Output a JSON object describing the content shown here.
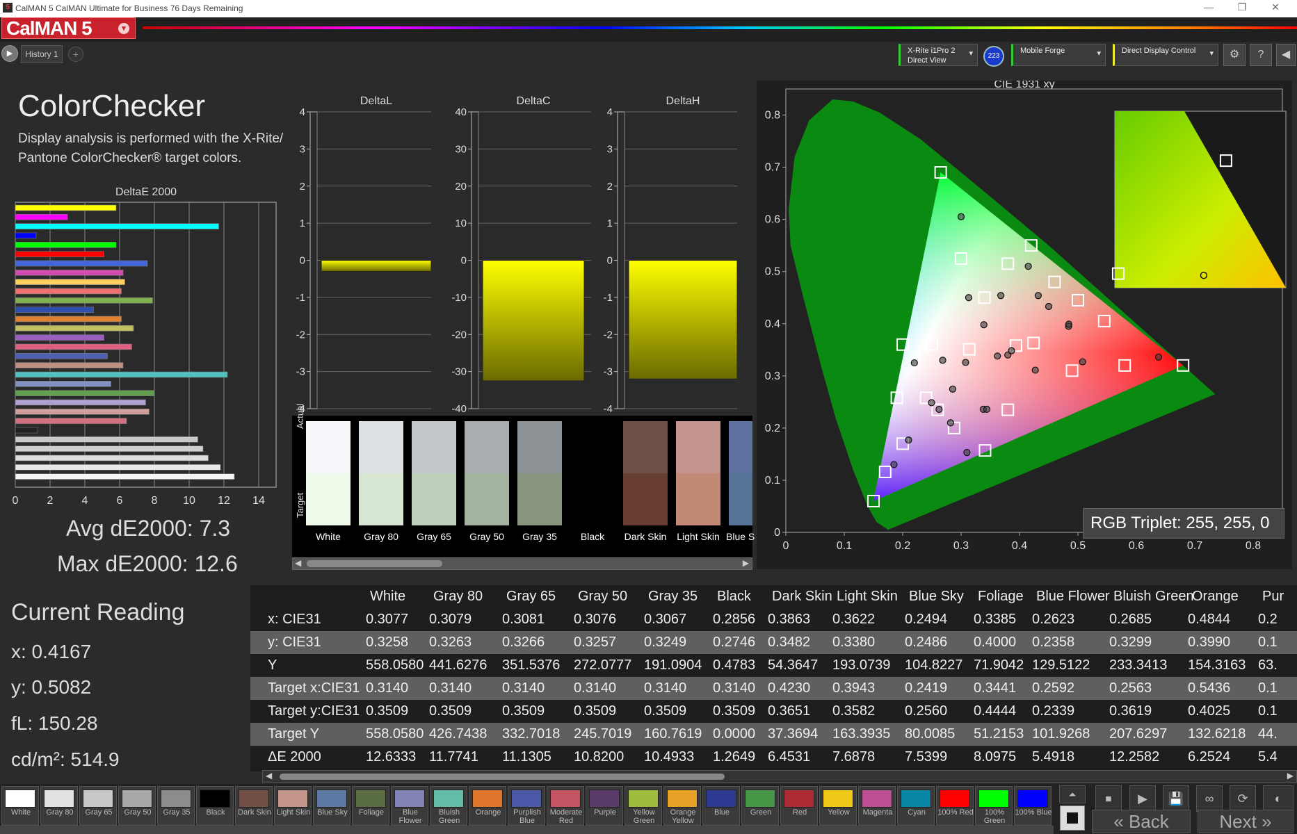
{
  "window": {
    "title": "CalMAN 5 CalMAN Ultimate for Business 76 Days Remaining",
    "minimize": "—",
    "maximize": "❐",
    "close": "✕"
  },
  "app": {
    "logo": "CalMAN 5",
    "logo_caret": "▾"
  },
  "history": {
    "play": "▶",
    "tab": "History 1",
    "add": "+"
  },
  "devices": {
    "meter_line1": "X-Rite i1Pro 2",
    "meter_line2": "Direct View",
    "meter_badge": "223",
    "source": "Mobile Forge",
    "display": "Direct Display Control",
    "caret": "▾",
    "settings_icon": "⚙",
    "help_icon": "?",
    "collapse_icon": "◀"
  },
  "panel": {
    "title": "ColorChecker",
    "subtitle": "Display analysis is performed with the X-Rite/ Pantone ColorChecker® target colors.",
    "avg": "Avg dE2000: 7.3",
    "max": "Max dE2000: 12.6"
  },
  "current_reading": {
    "title": "Current Reading",
    "x": "x: 0.4167",
    "y": "y: 0.5082",
    "fl": "fL: 150.28",
    "cdm2": "cd/m²: 514.9"
  },
  "chart_data": [
    {
      "type": "bar",
      "orientation": "horizontal",
      "title": "DeltaE 2000",
      "xlim": [
        0,
        15
      ],
      "xticks": [
        0,
        2,
        4,
        6,
        8,
        10,
        12,
        14
      ],
      "values": [
        5.8,
        3.0,
        11.7,
        1.2,
        5.8,
        5.1,
        7.6,
        6.2,
        6.3,
        6.1,
        7.9,
        4.5,
        6.1,
        6.8,
        5.1,
        6.7,
        5.3,
        6.2,
        12.2,
        5.5,
        8.0,
        7.5,
        7.7,
        6.4,
        1.3,
        10.5,
        10.8,
        11.1,
        11.8,
        12.6
      ],
      "colors": [
        "#ffff00",
        "#ff00ff",
        "#00ffff",
        "#0000ff",
        "#00ff00",
        "#ff0000",
        "#4466dd",
        "#d04cb0",
        "#ffd060",
        "#ee7070",
        "#80b050",
        "#3050b0",
        "#e08030",
        "#c0c060",
        "#9a60c0",
        "#e06080",
        "#5060b0",
        "#c09080",
        "#50c0c0",
        "#8090c0",
        "#60a050",
        "#b0a0d0",
        "#d0a0a0",
        "#d07080",
        "#222222",
        "#c8c8c8",
        "#d0d0d0",
        "#dddddd",
        "#e8e8e8",
        "#f4f4f4"
      ]
    },
    {
      "type": "bar",
      "title": "DeltaL",
      "ylim": [
        -4,
        4
      ],
      "yticks": [
        "4",
        "3",
        "2",
        "1",
        "0",
        "-1",
        "-2",
        "-3",
        "-4"
      ],
      "value": -0.3
    },
    {
      "type": "bar",
      "title": "DeltaC",
      "ylim": [
        -40,
        40
      ],
      "yticks": [
        "40",
        "30",
        "20",
        "10",
        "0",
        "-10",
        "-20",
        "-30",
        "-40"
      ],
      "value": -32.5
    },
    {
      "type": "bar",
      "title": "DeltaH",
      "ylim": [
        -4,
        4
      ],
      "yticks": [
        "4",
        "3",
        "2",
        "1",
        "0",
        "-1",
        "-2",
        "-3",
        "-4"
      ],
      "value": -3.2
    },
    {
      "type": "scatter",
      "title": "CIE 1931 xy",
      "xlim": [
        0,
        0.85
      ],
      "ylim": [
        0,
        0.85
      ],
      "xticks": [
        "0",
        "0.1",
        "0.2",
        "0.3",
        "0.4",
        "0.5",
        "0.6",
        "0.7",
        "0.8"
      ],
      "yticks": [
        "0",
        "0.1",
        "0.2",
        "0.3",
        "0.4",
        "0.5",
        "0.6",
        "0.7",
        "0.8"
      ],
      "gamut": [
        [
          0.68,
          0.32
        ],
        [
          0.265,
          0.69
        ],
        [
          0.15,
          0.06
        ]
      ],
      "targets": [
        [
          0.265,
          0.69
        ],
        [
          0.3,
          0.525
        ],
        [
          0.38,
          0.515
        ],
        [
          0.42,
          0.55
        ],
        [
          0.46,
          0.48
        ],
        [
          0.34,
          0.45
        ],
        [
          0.5,
          0.445
        ],
        [
          0.545,
          0.405
        ],
        [
          0.2,
          0.36
        ],
        [
          0.25,
          0.36
        ],
        [
          0.314,
          0.351
        ],
        [
          0.394,
          0.358
        ],
        [
          0.424,
          0.363
        ],
        [
          0.68,
          0.32
        ],
        [
          0.58,
          0.32
        ],
        [
          0.49,
          0.31
        ],
        [
          0.19,
          0.258
        ],
        [
          0.24,
          0.258
        ],
        [
          0.26,
          0.235
        ],
        [
          0.288,
          0.2
        ],
        [
          0.38,
          0.235
        ],
        [
          0.2,
          0.17
        ],
        [
          0.17,
          0.116
        ],
        [
          0.15,
          0.06
        ],
        [
          0.341,
          0.157
        ]
      ],
      "actuals": [
        [
          0.3,
          0.605
        ],
        [
          0.415,
          0.51
        ],
        [
          0.313,
          0.45
        ],
        [
          0.368,
          0.454
        ],
        [
          0.432,
          0.454
        ],
        [
          0.45,
          0.433
        ],
        [
          0.484,
          0.395
        ],
        [
          0.339,
          0.398
        ],
        [
          0.38,
          0.34
        ],
        [
          0.3077,
          0.3258
        ],
        [
          0.2856,
          0.2746
        ],
        [
          0.3863,
          0.3482
        ],
        [
          0.3622,
          0.338
        ],
        [
          0.2494,
          0.2486
        ],
        [
          0.2623,
          0.2358
        ],
        [
          0.2685,
          0.3299
        ],
        [
          0.4844,
          0.399
        ],
        [
          0.638,
          0.336
        ],
        [
          0.508,
          0.327
        ],
        [
          0.427,
          0.311
        ],
        [
          0.338,
          0.236
        ],
        [
          0.282,
          0.21
        ],
        [
          0.31,
          0.153
        ],
        [
          0.185,
          0.13
        ],
        [
          0.21,
          0.177
        ],
        [
          0.22,
          0.325
        ],
        [
          0.344,
          0.236
        ]
      ],
      "inset_targets": [
        [
          0.02,
          0.08
        ],
        [
          0.65,
          0.72
        ]
      ],
      "inset_actuals": [
        [
          0.52,
          0.07
        ]
      ]
    }
  ],
  "swatches": {
    "actual_label": "Actual",
    "target_label": "Target",
    "items": [
      {
        "name": "White",
        "actual": "#f6f8fb",
        "target": "#eef9ea"
      },
      {
        "name": "Gray 80",
        "actual": "#dde1e5",
        "target": "#d6e6d2"
      },
      {
        "name": "Gray 65",
        "actual": "#c3c8cc",
        "target": "#bfd0bc"
      },
      {
        "name": "Gray 50",
        "actual": "#a8adb2",
        "target": "#a3b39f"
      },
      {
        "name": "Gray 35",
        "actual": "#8d9296",
        "target": "#87957f"
      },
      {
        "name": "Black",
        "actual": "#000000",
        "target": "#000000"
      },
      {
        "name": "Dark Skin",
        "actual": "#6d4e48",
        "target": "#663d30"
      },
      {
        "name": "Light Skin",
        "actual": "#c3948e",
        "target": "#c28a74"
      },
      {
        "name": "Blue Sky",
        "actual": "#6072a0",
        "target": "#557396"
      }
    ]
  },
  "table": {
    "columns": [
      "White",
      "Gray 80",
      "Gray 65",
      "Gray 50",
      "Gray 35",
      "Black",
      "Dark Skin",
      "Light Skin",
      "Blue Sky",
      "Foliage",
      "Blue Flower",
      "Bluish Green",
      "Orange",
      "Pur"
    ],
    "rows": [
      {
        "label": "x: CIE31",
        "values": [
          "0.3077",
          "0.3079",
          "0.3081",
          "0.3076",
          "0.3067",
          "0.2856",
          "0.3863",
          "0.3622",
          "0.2494",
          "0.3385",
          "0.2623",
          "0.2685",
          "0.4844",
          "0.2"
        ]
      },
      {
        "label": "y: CIE31",
        "values": [
          "0.3258",
          "0.3263",
          "0.3266",
          "0.3257",
          "0.3249",
          "0.2746",
          "0.3482",
          "0.3380",
          "0.2486",
          "0.4000",
          "0.2358",
          "0.3299",
          "0.3990",
          "0.1"
        ]
      },
      {
        "label": "Y",
        "values": [
          "558.0580",
          "441.6276",
          "351.5376",
          "272.0777",
          "191.0904",
          "0.4783",
          "54.3647",
          "193.0739",
          "104.8227",
          "71.9042",
          "129.5122",
          "233.3413",
          "154.3163",
          "63."
        ]
      },
      {
        "label": "Target x:CIE31",
        "values": [
          "0.3140",
          "0.3140",
          "0.3140",
          "0.3140",
          "0.3140",
          "0.3140",
          "0.4230",
          "0.3943",
          "0.2419",
          "0.3441",
          "0.2592",
          "0.2563",
          "0.5436",
          "0.1"
        ]
      },
      {
        "label": "Target y:CIE31",
        "values": [
          "0.3509",
          "0.3509",
          "0.3509",
          "0.3509",
          "0.3509",
          "0.3509",
          "0.3651",
          "0.3582",
          "0.2560",
          "0.4444",
          "0.2339",
          "0.3619",
          "0.4025",
          "0.1"
        ]
      },
      {
        "label": "Target Y",
        "values": [
          "558.0580",
          "426.7438",
          "332.7018",
          "245.7019",
          "160.7619",
          "0.0000",
          "37.3694",
          "163.3935",
          "80.0085",
          "51.2153",
          "101.9268",
          "207.6297",
          "132.6218",
          "44."
        ]
      },
      {
        "label": "ΔE 2000",
        "values": [
          "12.6333",
          "11.7741",
          "11.1305",
          "10.8200",
          "10.4933",
          "1.2649",
          "6.4531",
          "7.6878",
          "7.5399",
          "8.0975",
          "5.4918",
          "12.2582",
          "6.2524",
          "5.4"
        ]
      }
    ]
  },
  "rgb_triplet": "RGB Triplet: 255, 255, 0",
  "bottom_swatches": [
    {
      "label": "White",
      "color": "#ffffff"
    },
    {
      "label": "Gray 80",
      "color": "#e2e2e2"
    },
    {
      "label": "Gray 65",
      "color": "#c8c8c8"
    },
    {
      "label": "Gray 50",
      "color": "#a9a9a9"
    },
    {
      "label": "Gray 35",
      "color": "#8c8c8c"
    },
    {
      "label": "Black",
      "color": "#000000"
    },
    {
      "label": "Dark Skin",
      "color": "#734e45"
    },
    {
      "label": "Light Skin",
      "color": "#c4968a"
    },
    {
      "label": "Blue Sky",
      "color": "#5d7aa4"
    },
    {
      "label": "Foliage",
      "color": "#5a6e42"
    },
    {
      "label": "Blue Flower",
      "color": "#8282b4"
    },
    {
      "label": "Bluish Green",
      "color": "#62bca8"
    },
    {
      "label": "Orange",
      "color": "#e0762c"
    },
    {
      "label": "Purplish Blue",
      "color": "#4a58a8"
    },
    {
      "label": "Moderate Red",
      "color": "#c45462"
    },
    {
      "label": "Purple",
      "color": "#5a3a6a"
    },
    {
      "label": "Yellow Green",
      "color": "#a0bc3e"
    },
    {
      "label": "Orange Yellow",
      "color": "#e8a028"
    },
    {
      "label": "Blue",
      "color": "#2c3a94"
    },
    {
      "label": "Green",
      "color": "#469848"
    },
    {
      "label": "Red",
      "color": "#b02c34"
    },
    {
      "label": "Yellow",
      "color": "#f0c818"
    },
    {
      "label": "Magenta",
      "color": "#be4e94"
    },
    {
      "label": "Cyan",
      "color": "#0888a6"
    },
    {
      "label": "100% Red",
      "color": "#ff0000"
    },
    {
      "label": "100% Green",
      "color": "#00ff00"
    },
    {
      "label": "100% Blue",
      "color": "#0000ff"
    }
  ],
  "controls": {
    "up": "⏶",
    "stop": "⏹",
    "play": "▶",
    "save": "💾",
    "loop": "∞",
    "refresh": "⟳",
    "extra": "◐",
    "back": "Back",
    "next": "Next",
    "back_icon": "«",
    "next_icon": "»"
  }
}
